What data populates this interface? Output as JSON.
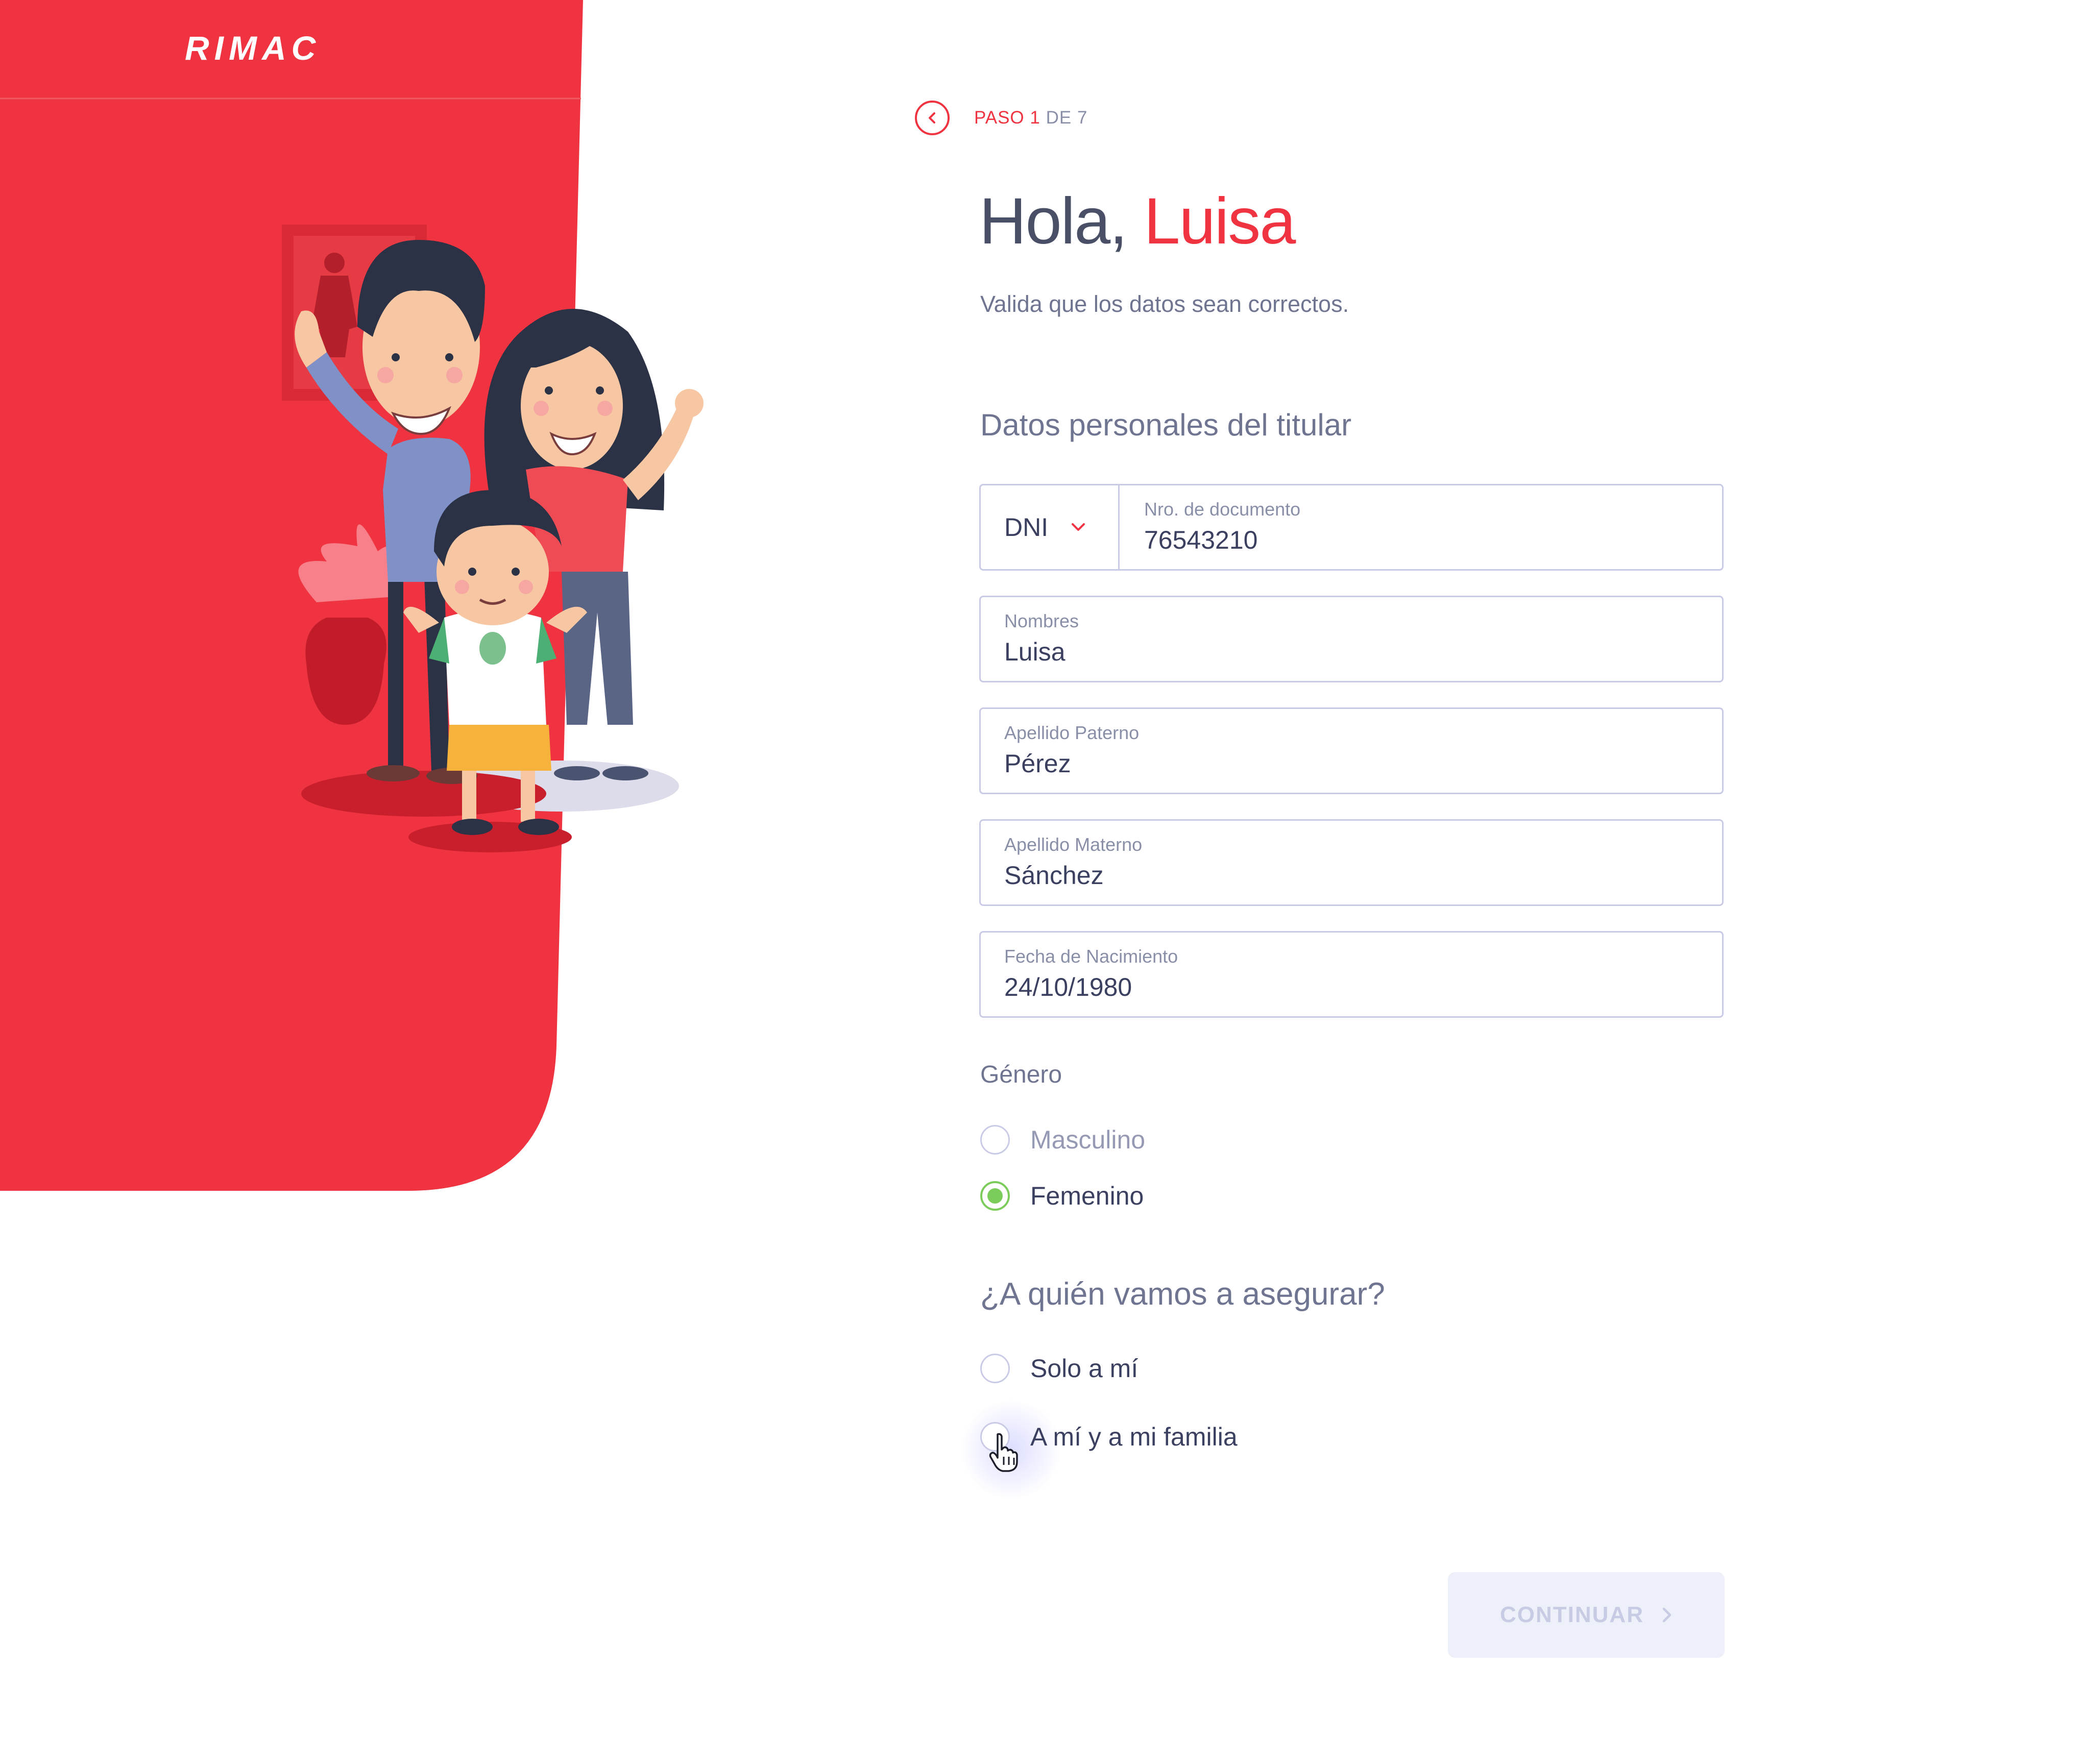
{
  "brand": {
    "logo_text": "RIMAC",
    "accent_color": "#ef3340",
    "success_color": "#7ccc5b"
  },
  "step": {
    "label": "PASO",
    "current": "1",
    "of": "DE",
    "total": "7",
    "back_icon": "chevron-left-icon"
  },
  "greeting": {
    "prefix": "Hola, ",
    "name": "Luisa"
  },
  "subtitle": "Valida que los datos sean correctos.",
  "section_title": "Datos personales del titular",
  "form": {
    "document_type": {
      "value": "DNI",
      "icon": "chevron-down-icon"
    },
    "document_number": {
      "label": "Nro. de documento",
      "value": "76543210"
    },
    "first_name": {
      "label": "Nombres",
      "value": "Luisa"
    },
    "paternal_surname": {
      "label": "Apellido Paterno",
      "value": "Pérez"
    },
    "maternal_surname": {
      "label": "Apellido Materno",
      "value": "Sánchez"
    },
    "birth_date": {
      "label": "Fecha de Nacimiento",
      "value": "24/10/1980"
    }
  },
  "gender": {
    "label": "Género",
    "options": [
      {
        "label": "Masculino",
        "selected": false
      },
      {
        "label": "Femenino",
        "selected": true
      }
    ]
  },
  "coverage": {
    "question": "¿A quién vamos a asegurar?",
    "options": [
      {
        "label": "Solo a mí",
        "selected": false
      },
      {
        "label": "A mí y a mi familia",
        "selected": false
      }
    ]
  },
  "continue_button": {
    "label": "CONTINUAR",
    "icon": "chevron-right-icon",
    "enabled": false
  }
}
